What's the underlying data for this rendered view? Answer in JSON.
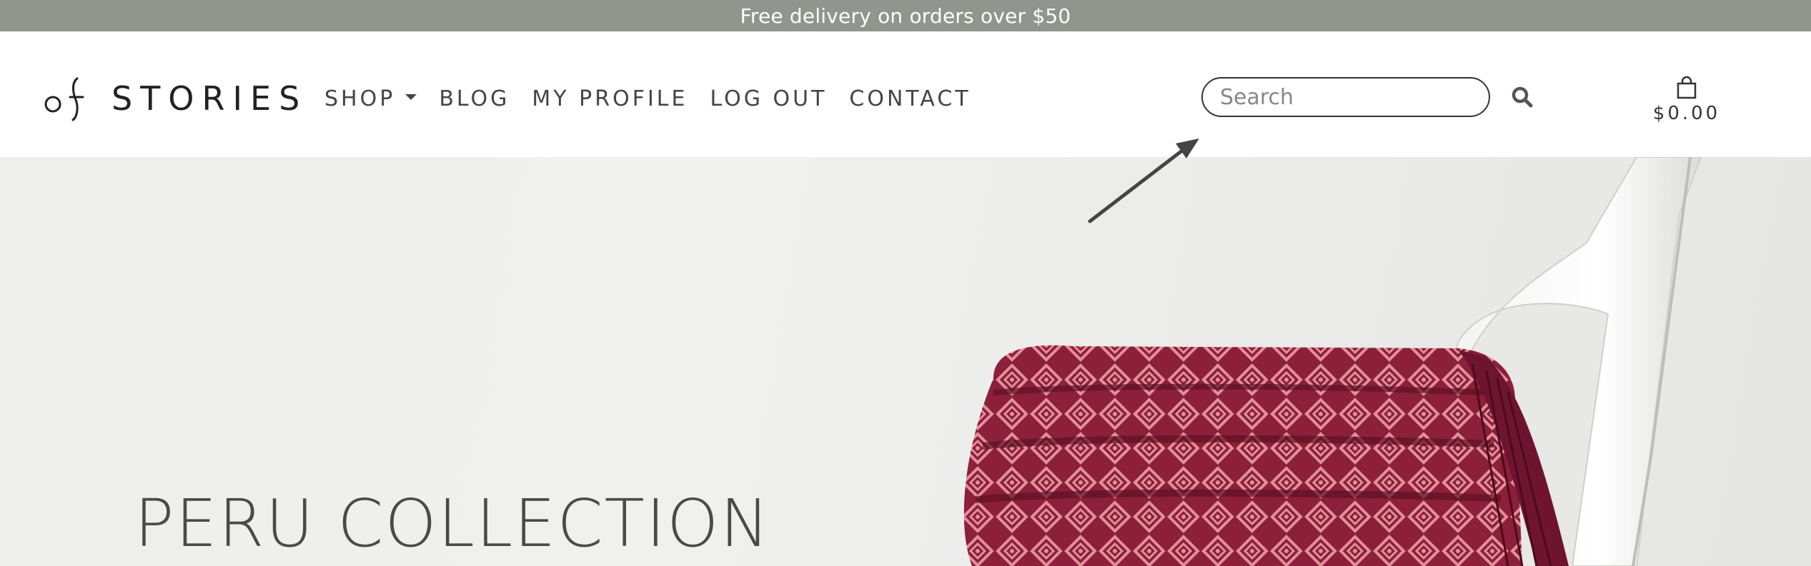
{
  "promo": {
    "text": "Free delivery on orders over $50"
  },
  "brand": {
    "logo_text": "STORIES"
  },
  "nav": {
    "items": [
      {
        "label": "SHOP",
        "has_dropdown": true
      },
      {
        "label": "BLOG"
      },
      {
        "label": "MY PROFILE"
      },
      {
        "label": "LOG OUT"
      },
      {
        "label": "CONTACT"
      }
    ]
  },
  "search": {
    "placeholder": "Search",
    "value": ""
  },
  "cart": {
    "amount": "$0.00"
  },
  "hero": {
    "title": "PERU COLLECTION"
  },
  "icons": {
    "search": "search-icon",
    "cart": "shopping-bag-icon",
    "dropdown": "caret-down-icon",
    "annotation": "arrow-icon"
  },
  "colors": {
    "promo_bg": "#90958e",
    "text_dark": "#333333",
    "blanket_red": "#8c1f3a",
    "blanket_pink": "#e2909a"
  }
}
